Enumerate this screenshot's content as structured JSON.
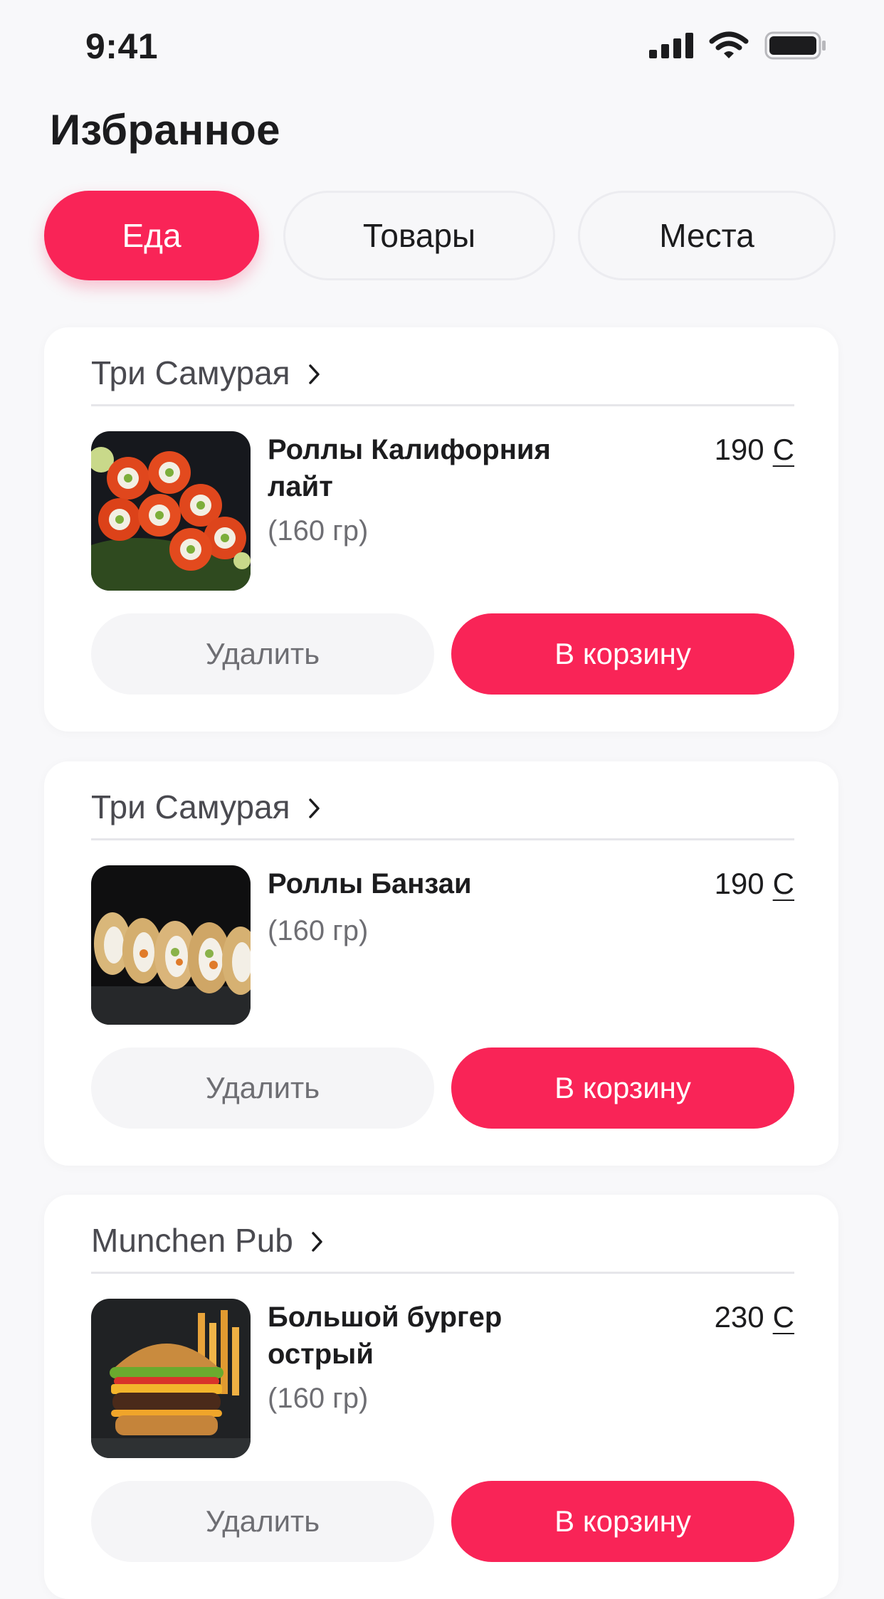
{
  "status_bar": {
    "time": "9:41"
  },
  "header": {
    "title": "Избранное"
  },
  "tabs": [
    {
      "label": "Еда",
      "active": true
    },
    {
      "label": "Товары",
      "active": false
    },
    {
      "label": "Места",
      "active": false
    }
  ],
  "colors": {
    "accent": "#f92457",
    "background": "#f8f8fa",
    "card": "#ffffff",
    "muted_text": "#6e6e73"
  },
  "items": [
    {
      "shop": "Три Самурая",
      "name": "Роллы Калифорния лайт",
      "weight": "(160 гр)",
      "price": "190",
      "currency": "С",
      "remove_label": "Удалить",
      "cart_label": "В корзину",
      "image": "sushi-rolls-red-roe"
    },
    {
      "shop": "Три Самурая",
      "name": "Роллы Банзаи",
      "weight": "(160 гр)",
      "price": "190",
      "currency": "С",
      "remove_label": "Удалить",
      "cart_label": "В корзину",
      "image": "sushi-rolls-sesame"
    },
    {
      "shop": "Munchen Pub",
      "name": "Большой бургер острый",
      "weight": "(160 гр)",
      "price": "230",
      "currency": "С",
      "remove_label": "Удалить",
      "cart_label": "В корзину",
      "image": "burger-with-fries"
    }
  ]
}
